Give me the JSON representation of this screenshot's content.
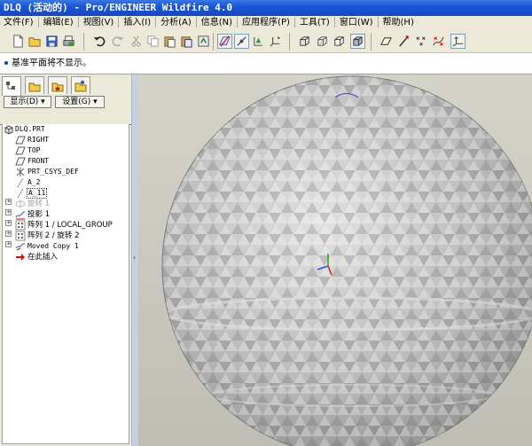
{
  "window": {
    "title": "DLQ (活动的) - Pro/ENGINEER Wildfire 4.0"
  },
  "menu": [
    "文件(F)",
    "编辑(E)",
    "视图(V)",
    "插入(I)",
    "分析(A)",
    "信息(N)",
    "应用程序(P)",
    "工具(T)",
    "窗口(W)",
    "帮助(H)"
  ],
  "message": "基准平面将不显示。",
  "panel": {
    "show_label": "显示(D) ▾",
    "settings_label": "设置(G) ▾"
  },
  "tree": {
    "root": "DLQ.PRT",
    "items": [
      "RIGHT",
      "TOP",
      "FRONT",
      "PRT_CSYS_DEF",
      "A_2",
      "A_11",
      "旋转 1",
      "投影 1",
      "阵列 1 / LOCAL_GROUP",
      "阵列 2 / 旋转 2",
      "Moved Copy 1",
      "在此插入"
    ]
  },
  "colors": {
    "title_bar": "#1a56d6",
    "viewport": "#cac9bf",
    "sphere_face": "#bdbdbd",
    "insert_arrow": "#c8101a"
  }
}
